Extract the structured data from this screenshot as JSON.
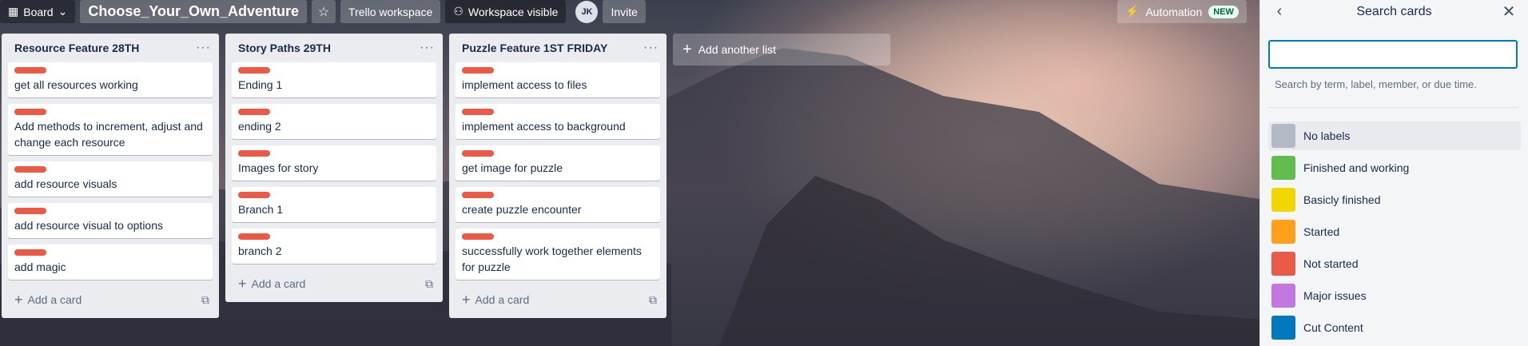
{
  "header": {
    "board_view": "Board",
    "board_title": "Choose_Your_Own_Adventure",
    "workspace": "Trello workspace",
    "visibility": "Workspace visible",
    "avatar_initials": "JK",
    "invite": "Invite",
    "automation": "Automation",
    "new_badge": "NEW"
  },
  "lists": [
    {
      "title": "Resource Feature 28TH",
      "cards": [
        "get all resources working",
        "Add methods to increment, adjust and change each resource",
        "add resource visuals",
        "add resource visual to options",
        "add magic"
      ],
      "add_card": "Add a card"
    },
    {
      "title": "Story Paths 29TH",
      "cards": [
        "Ending 1",
        "ending 2",
        "Images for story",
        "Branch 1",
        "branch 2"
      ],
      "add_card": "Add a card"
    },
    {
      "title": "Puzzle Feature 1ST FRIDAY",
      "cards": [
        "implement access to files",
        "implement access to background",
        "get image for puzzle",
        "create puzzle encounter",
        "successfully work together elements for puzzle"
      ],
      "add_card": "Add a card"
    }
  ],
  "add_list": "Add another list",
  "sidebar": {
    "title": "Search cards",
    "search_value": "",
    "hint": "Search by term, label, member, or due time.",
    "labels": [
      {
        "name": "No labels",
        "color": "#b3bac5"
      },
      {
        "name": "Finished and working",
        "color": "#61bd4f"
      },
      {
        "name": "Basicly finished",
        "color": "#f2d600"
      },
      {
        "name": "Started",
        "color": "#ff9f1a"
      },
      {
        "name": "Not started",
        "color": "#eb5a46"
      },
      {
        "name": "Major issues",
        "color": "#c377e0"
      },
      {
        "name": "Cut Content",
        "color": "#0079bf"
      }
    ]
  },
  "colors": {
    "card_label": "#eb5a46",
    "accent": "#0079bf"
  }
}
